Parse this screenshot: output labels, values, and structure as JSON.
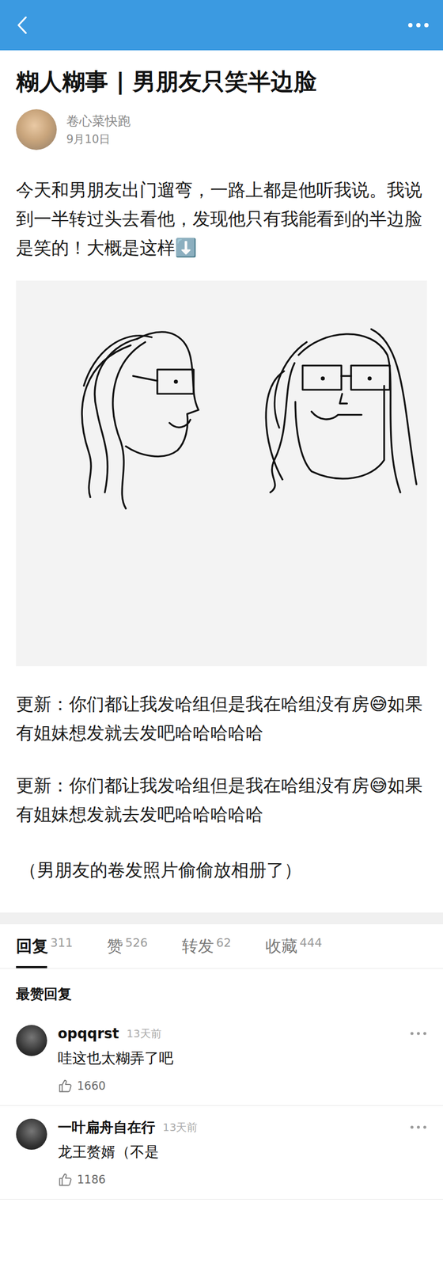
{
  "post": {
    "title": "糊人糊事 | 男朋友只笑半边脸",
    "author": "卷心菜快跑",
    "date": "9月10日",
    "body": "今天和男朋友出门遛弯，一路上都是他听我说。我说到一半转过头去看他，发现他只有我能看到的半边脸是笑的！大概是这样⬇️",
    "updates": [
      "更新：你们都让我发哈组但是我在哈组没有房😅如果有姐妹想发就去发吧哈哈哈哈哈",
      "更新：你们都让我发哈组但是我在哈组没有房😅如果有姐妹想发就去发吧哈哈哈哈哈"
    ],
    "note": "（男朋友的卷发照片偷偷放相册了）"
  },
  "tabs": [
    {
      "label": "回复",
      "count": "311",
      "selected": true
    },
    {
      "label": "赞",
      "count": "526",
      "selected": false
    },
    {
      "label": "转发",
      "count": "62",
      "selected": false
    },
    {
      "label": "收藏",
      "count": "444",
      "selected": false
    }
  ],
  "section_title": "最赞回复",
  "comments": [
    {
      "name": "opqqrst",
      "time": "13天前",
      "text": "哇这也太糊弄了吧",
      "likes": "1660"
    },
    {
      "name": "一叶扁舟自在行",
      "time": "13天前",
      "text": "龙王赘婿（不是",
      "likes": "1186"
    }
  ]
}
